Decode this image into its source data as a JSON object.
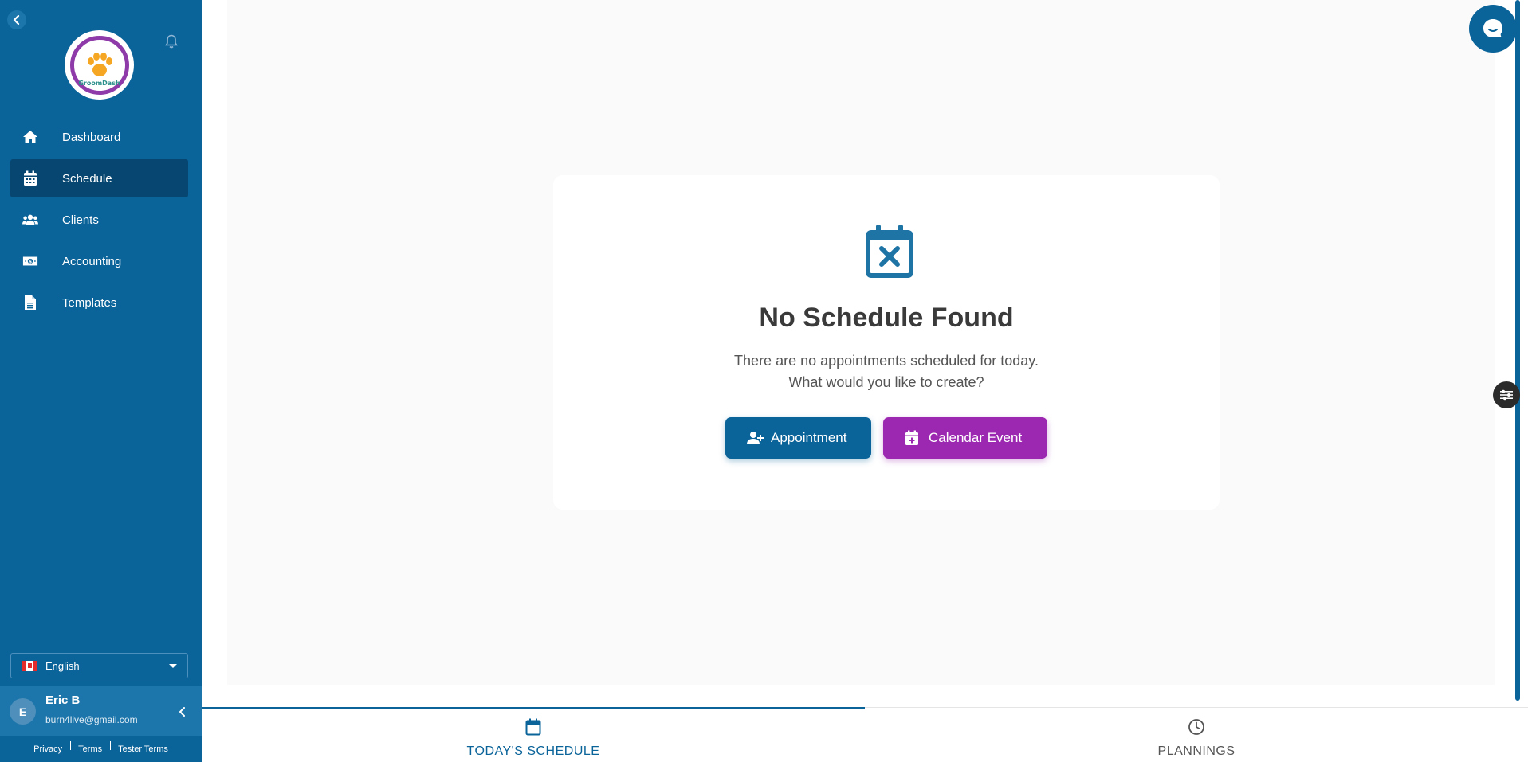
{
  "brand": {
    "logo_text": "GroomDash"
  },
  "sidebar": {
    "items": [
      {
        "label": "Dashboard",
        "icon": "home-icon"
      },
      {
        "label": "Schedule",
        "icon": "calendar-icon",
        "active": true
      },
      {
        "label": "Clients",
        "icon": "users-icon"
      },
      {
        "label": "Accounting",
        "icon": "money-icon"
      },
      {
        "label": "Templates",
        "icon": "document-icon"
      }
    ],
    "language": "English"
  },
  "user": {
    "initial": "E",
    "name": "Eric B",
    "email": "burn4live@gmail.com"
  },
  "legal": {
    "privacy": "Privacy",
    "terms": "Terms",
    "tester_terms": "Tester Terms"
  },
  "empty_state": {
    "title": "No Schedule Found",
    "line1": "There are no appointments scheduled for today.",
    "line2": "What would you like to create?",
    "appointment_label": "Appointment",
    "event_label": "Calendar Event"
  },
  "tabs": {
    "today": "TODAY'S SCHEDULE",
    "plannings": "PLANNINGS"
  },
  "colors": {
    "primary": "#0a6399",
    "primary_dark": "#074670",
    "accent_purple": "#9c27b0"
  }
}
